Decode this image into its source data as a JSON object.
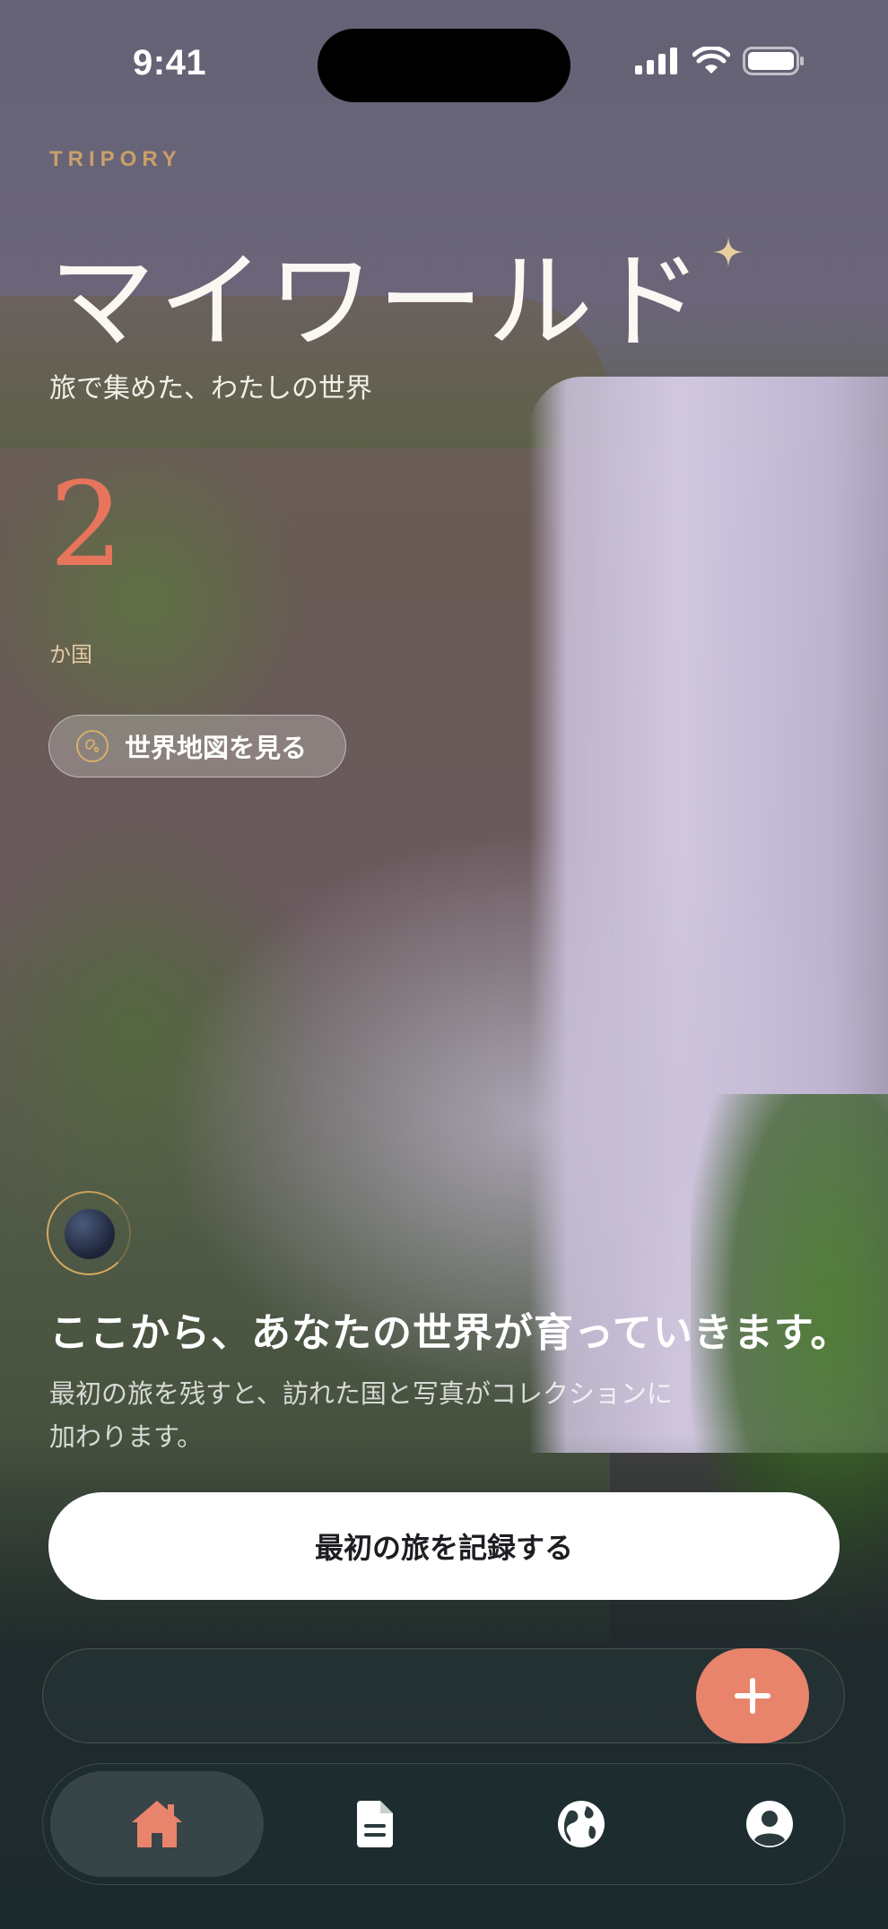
{
  "status_bar": {
    "time": "9:41"
  },
  "header": {
    "brand": "TRIPORY",
    "title": "マイワールド",
    "subtitle": "旅で集めた、わたしの世界"
  },
  "stats": {
    "country_count": "2",
    "unit": "か国"
  },
  "map_button": {
    "label": "世界地図を見る"
  },
  "empty_state": {
    "title": "ここから、あなたの世界が育っていきます。",
    "description_line1": "最初の旅を残すと、訪れた国と写真がコレクションに",
    "description_line2": "加わります。"
  },
  "cta": {
    "label": "最初の旅を記録する"
  },
  "tabs": [
    {
      "icon": "home-icon",
      "active": true
    },
    {
      "icon": "document-icon",
      "active": false
    },
    {
      "icon": "globe-icon",
      "active": false
    },
    {
      "icon": "profile-icon",
      "active": false
    }
  ],
  "colors": {
    "accent": "#e8846b",
    "brand_gold": "#c9a06a",
    "count_color": "#e6755c"
  }
}
